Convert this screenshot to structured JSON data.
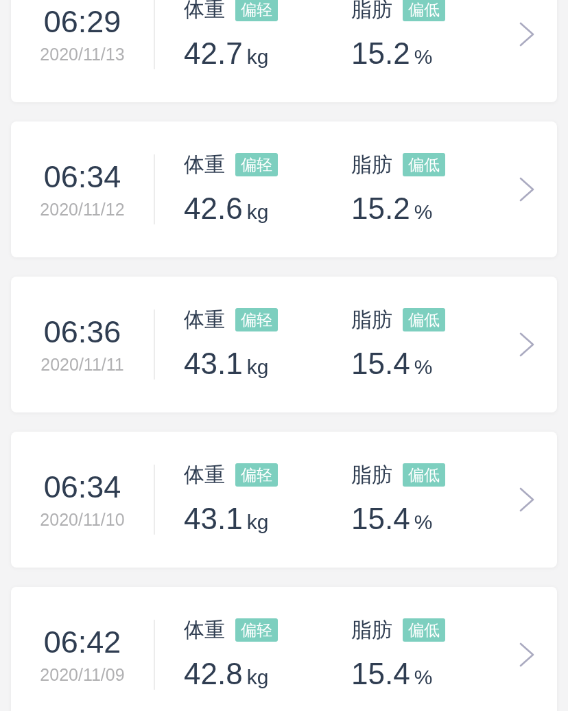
{
  "records": [
    {
      "time": "06:29",
      "date": "2020/11/13",
      "metrics": [
        {
          "label": "体重",
          "badge": "偏轻",
          "value": "42.7",
          "unit": "kg"
        },
        {
          "label": "脂肪",
          "badge": "偏低",
          "value": "15.2",
          "unit": "%"
        }
      ]
    },
    {
      "time": "06:34",
      "date": "2020/11/12",
      "metrics": [
        {
          "label": "体重",
          "badge": "偏轻",
          "value": "42.6",
          "unit": "kg"
        },
        {
          "label": "脂肪",
          "badge": "偏低",
          "value": "15.2",
          "unit": "%"
        }
      ]
    },
    {
      "time": "06:36",
      "date": "2020/11/11",
      "metrics": [
        {
          "label": "体重",
          "badge": "偏轻",
          "value": "43.1",
          "unit": "kg"
        },
        {
          "label": "脂肪",
          "badge": "偏低",
          "value": "15.4",
          "unit": "%"
        }
      ]
    },
    {
      "time": "06:34",
      "date": "2020/11/10",
      "metrics": [
        {
          "label": "体重",
          "badge": "偏轻",
          "value": "43.1",
          "unit": "kg"
        },
        {
          "label": "脂肪",
          "badge": "偏低",
          "value": "15.4",
          "unit": "%"
        }
      ]
    },
    {
      "time": "06:42",
      "date": "2020/11/09",
      "metrics": [
        {
          "label": "体重",
          "badge": "偏轻",
          "value": "42.8",
          "unit": "kg"
        },
        {
          "label": "脂肪",
          "badge": "偏低",
          "value": "15.4",
          "unit": "%"
        }
      ]
    }
  ]
}
